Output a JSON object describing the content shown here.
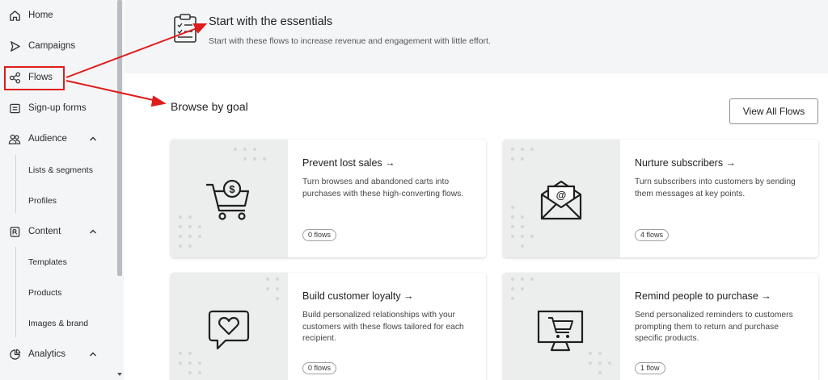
{
  "sidebar": {
    "items": [
      {
        "label": "Home",
        "icon": "home-icon"
      },
      {
        "label": "Campaigns",
        "icon": "send-icon"
      },
      {
        "label": "Flows",
        "icon": "flows-icon"
      },
      {
        "label": "Sign-up forms",
        "icon": "form-icon"
      },
      {
        "label": "Audience",
        "icon": "people-icon"
      },
      {
        "label": "Content",
        "icon": "content-icon"
      },
      {
        "label": "Analytics",
        "icon": "analytics-icon"
      }
    ],
    "audience_sub": [
      "Lists & segments",
      "Profiles"
    ],
    "content_sub": [
      "Templates",
      "Products",
      "Images & brand"
    ]
  },
  "banner": {
    "title": "Start with the essentials",
    "subtitle": "Start with these flows to increase revenue and engagement with little effort."
  },
  "main": {
    "section_title": "Browse by goal",
    "view_all_label": "View All Flows",
    "cards": [
      {
        "title": "Prevent lost sales →",
        "desc": "Turn browses and abandoned carts into purchases with these high-converting flows.",
        "badge": "0 flows",
        "icon": "shopping-cart-dollar-icon"
      },
      {
        "title": "Nurture subscribers →",
        "desc": "Turn subscribers into customers by sending them messages at key points.",
        "badge": "4 flows",
        "icon": "email-envelope-icon"
      },
      {
        "title": "Build customer loyalty →",
        "desc": "Build personalized relationships with your customers with these flows tailored for each recipient.",
        "badge": "0 flows",
        "icon": "heart-message-icon"
      },
      {
        "title": "Remind people to purchase →",
        "desc": "Send personalized reminders to customers prompting them to return and purchase specific products.",
        "badge": "1 flow",
        "icon": "monitor-cart-icon"
      }
    ]
  },
  "colors": {
    "annotation_red": "#e01b1b",
    "sidebar_bg": "#f4f5f7",
    "card_art_bg": "#eceded"
  }
}
